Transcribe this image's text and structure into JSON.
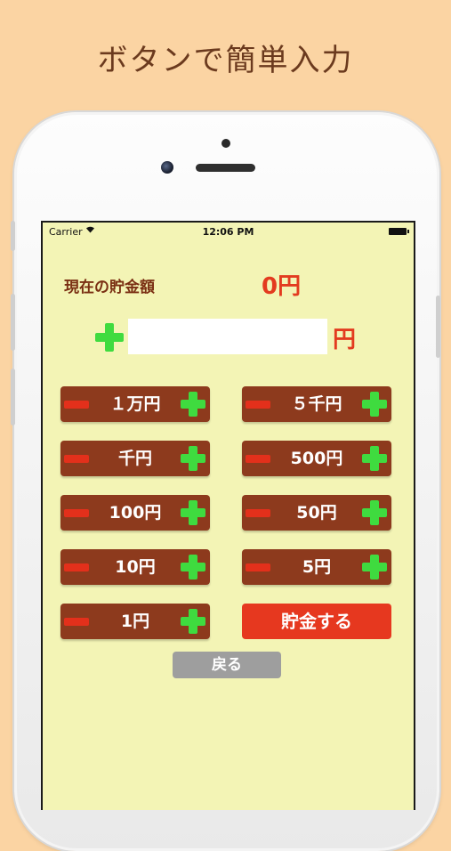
{
  "headline": "ボタンで簡単入力",
  "status_bar": {
    "carrier": "Carrier",
    "time": "12:06 PM"
  },
  "savings": {
    "label": "現在の貯金額",
    "amount": "0円"
  },
  "input": {
    "value": "",
    "placeholder": "",
    "unit": "円"
  },
  "denominations": [
    {
      "label": "１万円"
    },
    {
      "label": "５千円"
    },
    {
      "label": "千円"
    },
    {
      "label": "500円"
    },
    {
      "label": "100円"
    },
    {
      "label": "50円"
    },
    {
      "label": "10円"
    },
    {
      "label": "5円"
    },
    {
      "label": "1円"
    }
  ],
  "buttons": {
    "save": "貯金する",
    "back": "戻る"
  },
  "colors": {
    "background": "#fbd4a3",
    "screen": "#f3f4b5",
    "denom_button": "#8d3a1d",
    "accent_red": "#e33b1f",
    "plus_green": "#3fdb3f",
    "back_gray": "#9e9e9e"
  },
  "icons": {
    "plus": "green-plus-icon",
    "minus": "red-minus-icon",
    "wifi": "wifi-icon",
    "battery": "battery-icon"
  }
}
